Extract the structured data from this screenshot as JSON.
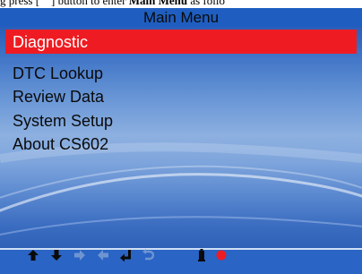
{
  "caption": {
    "before": "g press [",
    "middle": "] button to enter ",
    "bold": "Main Menu",
    "after": " as follo"
  },
  "screen": {
    "title": "Main Menu",
    "menu": {
      "selected_label": "Diagnostic",
      "items": [
        "DTC Lookup",
        "Review Data",
        "System Setup",
        "About  CS602"
      ]
    },
    "colors": {
      "title_bar": "#1f5ec0",
      "selection": "#ee1c22",
      "background": "#5b89d0",
      "icons": "#0a0a0a",
      "record": "#ee1c22"
    }
  },
  "softkeys": [
    {
      "icon": "arrow-up-icon",
      "active": true
    },
    {
      "icon": "arrow-down-icon",
      "active": true
    },
    {
      "icon": "arrow-right-icon",
      "active": false
    },
    {
      "icon": "arrow-left-icon",
      "active": false
    },
    {
      "icon": "enter-icon",
      "active": true
    },
    {
      "icon": "back-icon",
      "active": false
    },
    {
      "icon": "battery-icon",
      "active": true
    },
    {
      "icon": "record-icon",
      "active": true
    }
  ]
}
